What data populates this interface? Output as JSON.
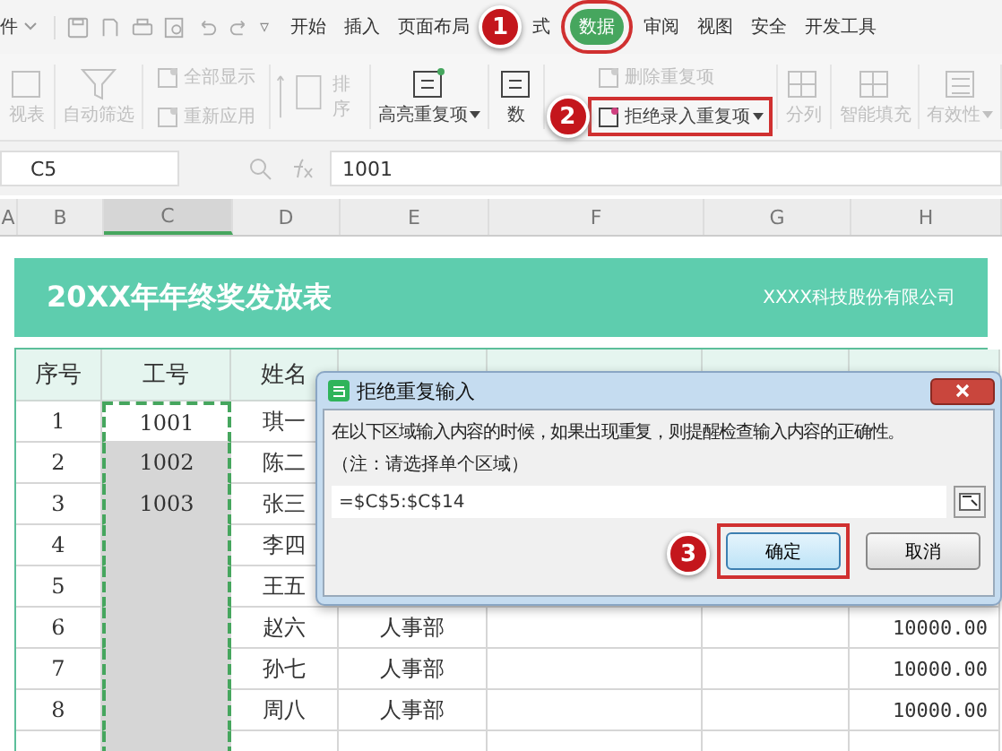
{
  "menu": {
    "file_label": "件",
    "quick_more": "▿",
    "tabs": [
      {
        "label": "开始",
        "selected": false
      },
      {
        "label": "插入",
        "selected": false
      },
      {
        "label": "页面布局",
        "selected": false
      },
      {
        "label": "式",
        "selected": false,
        "callout": "1"
      },
      {
        "label": "数据",
        "selected": true
      },
      {
        "label": "审阅",
        "selected": false
      },
      {
        "label": "视图",
        "selected": false
      },
      {
        "label": "安全",
        "selected": false
      },
      {
        "label": "开发工具",
        "selected": false
      }
    ]
  },
  "ribbon": [
    {
      "kind": "big",
      "label": "视表",
      "disabled": true
    },
    {
      "kind": "big",
      "label": "自动筛选",
      "disabled": true
    },
    {
      "kind": "pair",
      "items": [
        {
          "label": "全部显示",
          "disabled": true
        },
        {
          "label": "重新应用",
          "disabled": true
        }
      ]
    },
    {
      "kind": "sort",
      "label": "排序",
      "disabled": true
    },
    {
      "kind": "big",
      "label": "高亮重复项",
      "disabled": false,
      "dropdown": true
    },
    {
      "kind": "big",
      "label": "数",
      "disabled": false
    },
    {
      "kind": "pair",
      "items": [
        {
          "label": "删除重复项",
          "disabled": true
        },
        {
          "label": "拒绝录入重复项",
          "disabled": false,
          "dropdown": true,
          "callout": "2"
        }
      ]
    },
    {
      "kind": "big",
      "label": "分列",
      "disabled": true
    },
    {
      "kind": "big",
      "label": "智能填充",
      "disabled": true
    },
    {
      "kind": "big",
      "label": "有效性",
      "disabled": true,
      "dropdown": true
    }
  ],
  "formula_bar": {
    "cell": "C5",
    "value": "1001"
  },
  "columns": [
    {
      "label": "A",
      "selected": false
    },
    {
      "label": "B",
      "selected": false
    },
    {
      "label": "C",
      "selected": true
    },
    {
      "label": "D",
      "selected": false
    },
    {
      "label": "E",
      "selected": false
    },
    {
      "label": "F",
      "selected": false
    },
    {
      "label": "G",
      "selected": false
    },
    {
      "label": "H",
      "selected": false
    }
  ],
  "sheet": {
    "title": "20XX年年终奖发放表",
    "company": "XXXX科技股份有限公司",
    "headers": [
      "序号",
      "工号",
      "姓名"
    ],
    "rows": [
      {
        "no": "1",
        "id": "1001",
        "name": "琪一",
        "active": true
      },
      {
        "no": "2",
        "id": "1002",
        "name": "陈二",
        "active": false
      },
      {
        "no": "3",
        "id": "1003",
        "name": "张三",
        "active": false
      },
      {
        "no": "4",
        "name": "李四",
        "active": false
      },
      {
        "no": "5",
        "name": "王五",
        "active": false
      },
      {
        "no": "6",
        "name": "赵六",
        "dept": "人事部",
        "bonus": "10000.00",
        "active": false
      },
      {
        "no": "7",
        "name": "孙七",
        "dept": "人事部",
        "bonus": "10000.00",
        "active": false
      },
      {
        "no": "8",
        "name": "周八",
        "dept": "人事部",
        "bonus": "10000.00",
        "active": false
      }
    ]
  },
  "dialog": {
    "title": "拒绝重复输入",
    "message": "在以下区域输入内容的时候，如果出现重复，则提醒检查输入内容的正确性。",
    "note": "（注：请选择单个区域）",
    "range": "=$C$5:$C$14",
    "buttons": [
      {
        "label": "确定",
        "selected": true,
        "callout": "3"
      },
      {
        "label": "取消",
        "selected": false
      }
    ]
  }
}
